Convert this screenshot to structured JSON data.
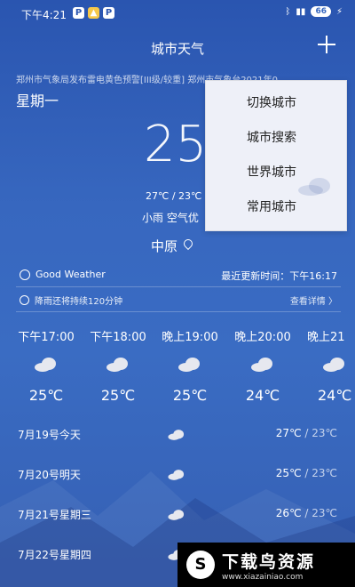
{
  "status_bar": {
    "time": "下午4:21",
    "battery": "66"
  },
  "header": {
    "title": "城市天气",
    "add_icon": "plus-icon"
  },
  "warning_text": "郑州市气象局发布雷电黄色预警[III级/较重]    郑州市气象台2021年0",
  "weekday": "星期一",
  "current": {
    "temperature": "25",
    "unit": "℃",
    "range": "27℃ / 23℃",
    "condition_line": "小雨   空气优",
    "location": "中原"
  },
  "menu": {
    "items": [
      "切换城市",
      "城市搜索",
      "世界城市",
      "常用城市"
    ]
  },
  "info": {
    "good_weather": "Good Weather",
    "update_time": "最近更新时间：下午16:17",
    "rain_notice": "降雨还将持续120分钟",
    "detail_link": "查看详情 〉"
  },
  "hourly": [
    {
      "time": "下午17:00",
      "temp": "25℃",
      "icon": "cloud-icon"
    },
    {
      "time": "下午18:00",
      "temp": "25℃",
      "icon": "cloud-icon"
    },
    {
      "time": "晚上19:00",
      "temp": "25℃",
      "icon": "cloud-icon"
    },
    {
      "time": "晚上20:00",
      "temp": "24℃",
      "icon": "cloud-icon"
    },
    {
      "time": "晚上21",
      "temp": "24℃",
      "icon": "cloud-icon"
    }
  ],
  "daily": [
    {
      "date": "7月19号今天",
      "high": "27℃",
      "low": "23℃",
      "icon": "cloud-icon"
    },
    {
      "date": "7月20号明天",
      "high": "25℃",
      "low": "23℃",
      "icon": "cloud-icon"
    },
    {
      "date": "7月21号星期三",
      "high": "26℃",
      "low": "23℃",
      "icon": "cloud-icon"
    },
    {
      "date": "7月22号星期四",
      "high": "",
      "low": "",
      "icon": "cloud-icon"
    }
  ],
  "watermark": {
    "logo": "S",
    "title": "下载鸟资源",
    "url": "www.xiazainiao.com"
  }
}
